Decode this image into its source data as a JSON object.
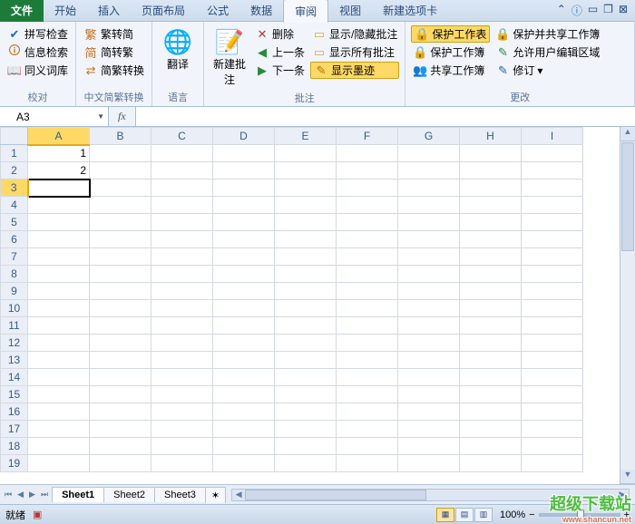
{
  "tabs": {
    "file": "文件",
    "items": [
      "开始",
      "插入",
      "页面布局",
      "公式",
      "数据",
      "审阅",
      "视图",
      "新建选项卡"
    ],
    "active": 5
  },
  "ribbon": {
    "proofing": {
      "label": "校对",
      "spell": "拼写检查",
      "research": "信息检索",
      "thesaurus": "同义词库"
    },
    "chinese": {
      "label": "中文简繁转换",
      "s2t": "繁转简",
      "t2s": "简转繁",
      "convert": "简繁转换"
    },
    "language": {
      "label": "语言",
      "translate": "翻译"
    },
    "comments": {
      "label": "批注",
      "new": "新建批注",
      "delete": "删除",
      "prev": "上一条",
      "next": "下一条",
      "showhide": "显示/隐藏批注",
      "showall": "显示所有批注",
      "ink": "显示墨迹"
    },
    "changes": {
      "label": "更改",
      "protect_sheet": "保护工作表",
      "protect_wb": "保护工作簿",
      "share_wb": "共享工作簿",
      "protect_share": "保护并共享工作簿",
      "allow_edit": "允许用户编辑区域",
      "track": "修订"
    }
  },
  "formula_bar": {
    "name": "A3",
    "fx": "fx",
    "value": ""
  },
  "grid": {
    "cols": [
      "A",
      "B",
      "C",
      "D",
      "E",
      "F",
      "G",
      "H",
      "I"
    ],
    "rows": 19,
    "active_cell": "A3",
    "active_col": 0,
    "active_row": 2,
    "data": {
      "A1": "1",
      "A2": "2"
    }
  },
  "sheets": {
    "tabs": [
      "Sheet1",
      "Sheet2",
      "Sheet3"
    ],
    "active": 0
  },
  "status": {
    "ready": "就绪",
    "zoom": "100%"
  },
  "watermark": {
    "line1": "超级下载站",
    "line2": "www.shancun.net"
  }
}
